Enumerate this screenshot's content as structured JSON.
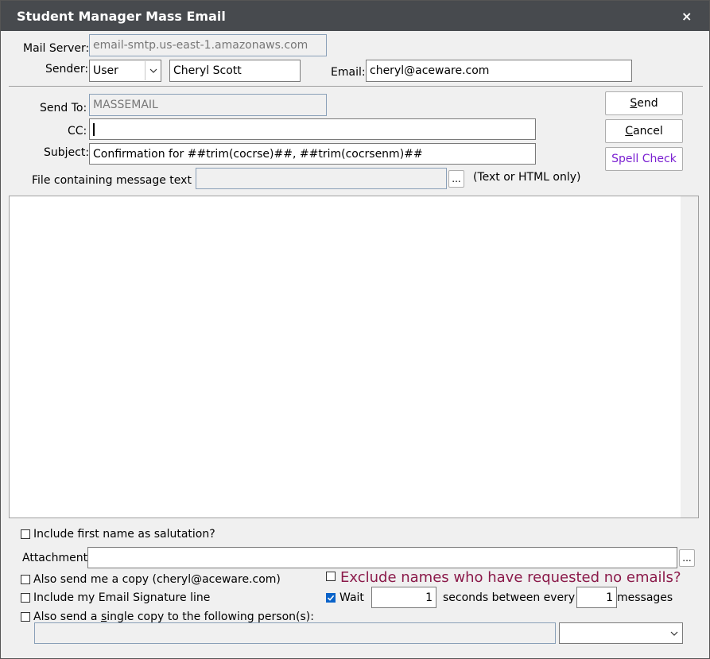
{
  "window": {
    "title": "Student Manager Mass Email",
    "close_glyph": "×"
  },
  "mail_server": {
    "label": "Mail Server:",
    "value": "email-smtp.us-east-1.amazonaws.com"
  },
  "sender": {
    "label": "Sender:",
    "type_value": "User",
    "name_value": "Cheryl Scott"
  },
  "email": {
    "label": "Email:",
    "value": "cheryl@aceware.com"
  },
  "send_to": {
    "label": "Send To:",
    "value": "MASSEMAIL"
  },
  "cc": {
    "label": "CC:",
    "value": ""
  },
  "subject": {
    "label": "Subject:",
    "value": "Confirmation for ##trim(cocrse)##, ##trim(cocrsenm)##"
  },
  "file_msg": {
    "label": "File containing message text",
    "value": "",
    "browse": "...",
    "hint": "(Text or HTML only)"
  },
  "buttons": {
    "send_prefix": "",
    "send_ul": "S",
    "send_rest": "end",
    "cancel_prefix": "",
    "cancel_ul": "C",
    "cancel_rest": "ancel",
    "spell": "Spell Check"
  },
  "options": {
    "salutation": {
      "label": "Include first name as salutation?",
      "checked": false
    },
    "attachment": {
      "label": "Attachment:",
      "value": "",
      "browse": "..."
    },
    "copy_me": {
      "label": "Also send me a copy (cheryl@aceware.com)",
      "checked": false
    },
    "signature": {
      "label": "Include my Email Signature line",
      "checked": false
    },
    "single_copy": {
      "label_prefix": "Also send a ",
      "label_ul": "s",
      "label_rest": "ingle copy to the following person(s):",
      "checked": false
    },
    "exclude": {
      "label": "Exclude names who have requested no emails?",
      "checked": false
    },
    "wait": {
      "label": "Wait",
      "checked": true,
      "seconds": "1",
      "between_label": "seconds between every",
      "messages": "1",
      "messages_label": "messages"
    }
  },
  "colors": {
    "titlebar": "#474a4e",
    "spell_check": "#7a1fd1",
    "exclude_text": "#8b1a4a",
    "checkbox_on": "#0a63c9"
  }
}
